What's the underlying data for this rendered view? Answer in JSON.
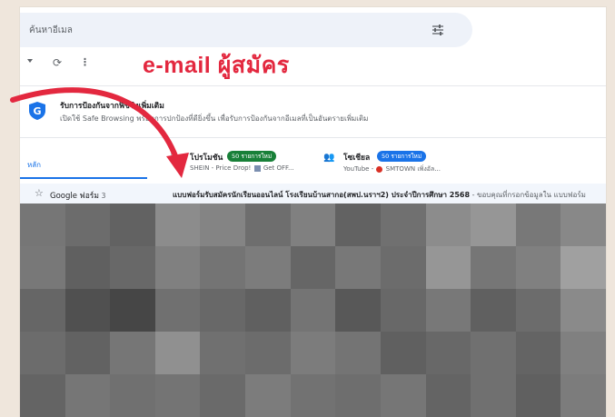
{
  "overlay_title": "e-mail ผู้สมัคร",
  "search": {
    "placeholder": "ค้นหาอีเมล",
    "filter_icon": "tune-icon"
  },
  "toolbar": {
    "select_icon": "chevron-down-icon",
    "refresh_icon": "refresh-icon",
    "more_icon": "more-vert-icon"
  },
  "notice": {
    "title": "รับการป้องกันจากฟิชชิงเพิ่มเติม",
    "body": "เปิดใช้ Safe Browsing พร้อมการปกป้องที่ดียิ่งขึ้น เพื่อรับการป้องกันจากอีเมลที่เป็นอันตรายเพิ่มเติม"
  },
  "tabs": {
    "primary": "หลัก",
    "promotions": {
      "label": "โปรโมชัน",
      "badge": "50 รายการใหม่",
      "badge_color": "#188038",
      "preview": "SHEIN - Price Drop! ",
      "preview_2": " Get OFF..."
    },
    "social": {
      "label": "โซเชียล",
      "badge": "50 รายการใหม่",
      "badge_color": "#1a73e8",
      "preview": "YouTube - ",
      "preview_2": " SMTOWN เพิ่งอัล..."
    }
  },
  "email": {
    "sender": "Google ฟอร์ม",
    "count": "3",
    "subject": "แบบฟอร์มรับสมัครนักเรียนออนไลน์ โรงเรียนบ้านสากอ(สพป.นราฯ2) ประจำปีการศึกษา 2568",
    "snippet": " - ขอบคุณที่กรอกข้อมูลใน แบบฟอร์ม"
  },
  "colors": {
    "accent": "#1a73e8",
    "overlay_text": "#e3283f",
    "arrow": "#e3283f"
  }
}
